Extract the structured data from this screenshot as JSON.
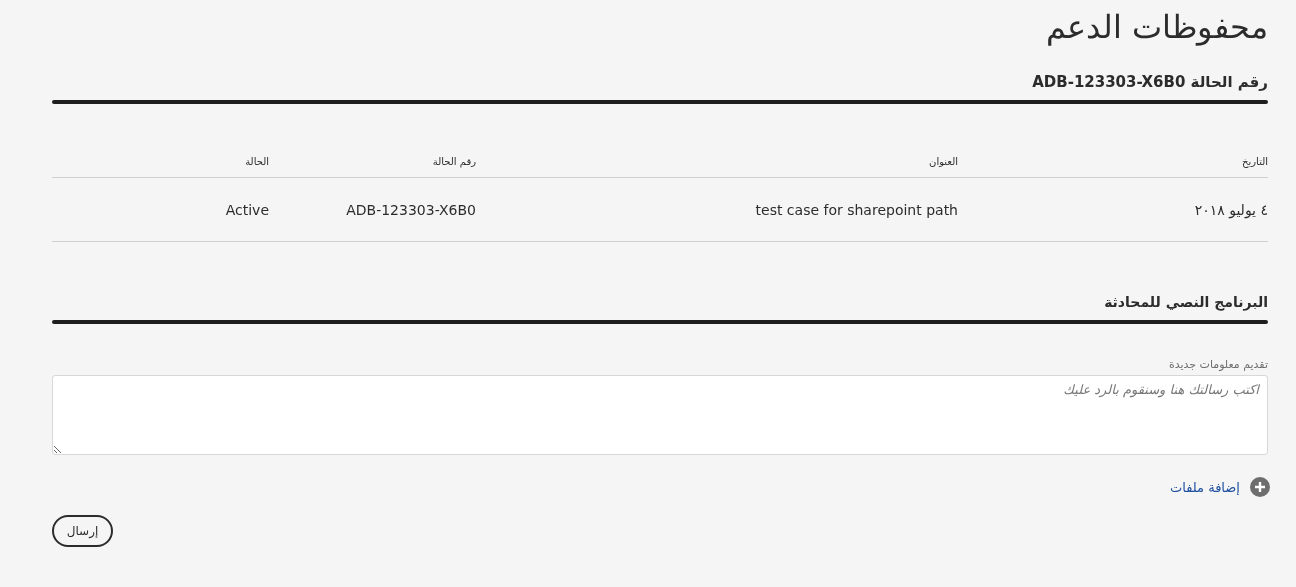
{
  "page": {
    "title": "محفوظات الدعم",
    "case_heading": "رقم الحالة ADB-123303-X6B0"
  },
  "table": {
    "columns": [
      "التاريخ",
      "العنوان",
      "رقم الحالة",
      "الحالة"
    ],
    "rows": [
      {
        "cells": [
          "٤ يوليو ٢٠١٨",
          "test case for sharepoint path",
          "ADB-123303-X6B0",
          "Active"
        ]
      }
    ]
  },
  "transcript": {
    "heading": "البرنامج النصي للمحادثة",
    "field_label": "تقديم معلومات جديدة",
    "placeholder": "اكتب رسالتك هنا وسنقوم بالرد عليك",
    "add_files": "إضافة ملفات",
    "submit": "إرسال"
  }
}
